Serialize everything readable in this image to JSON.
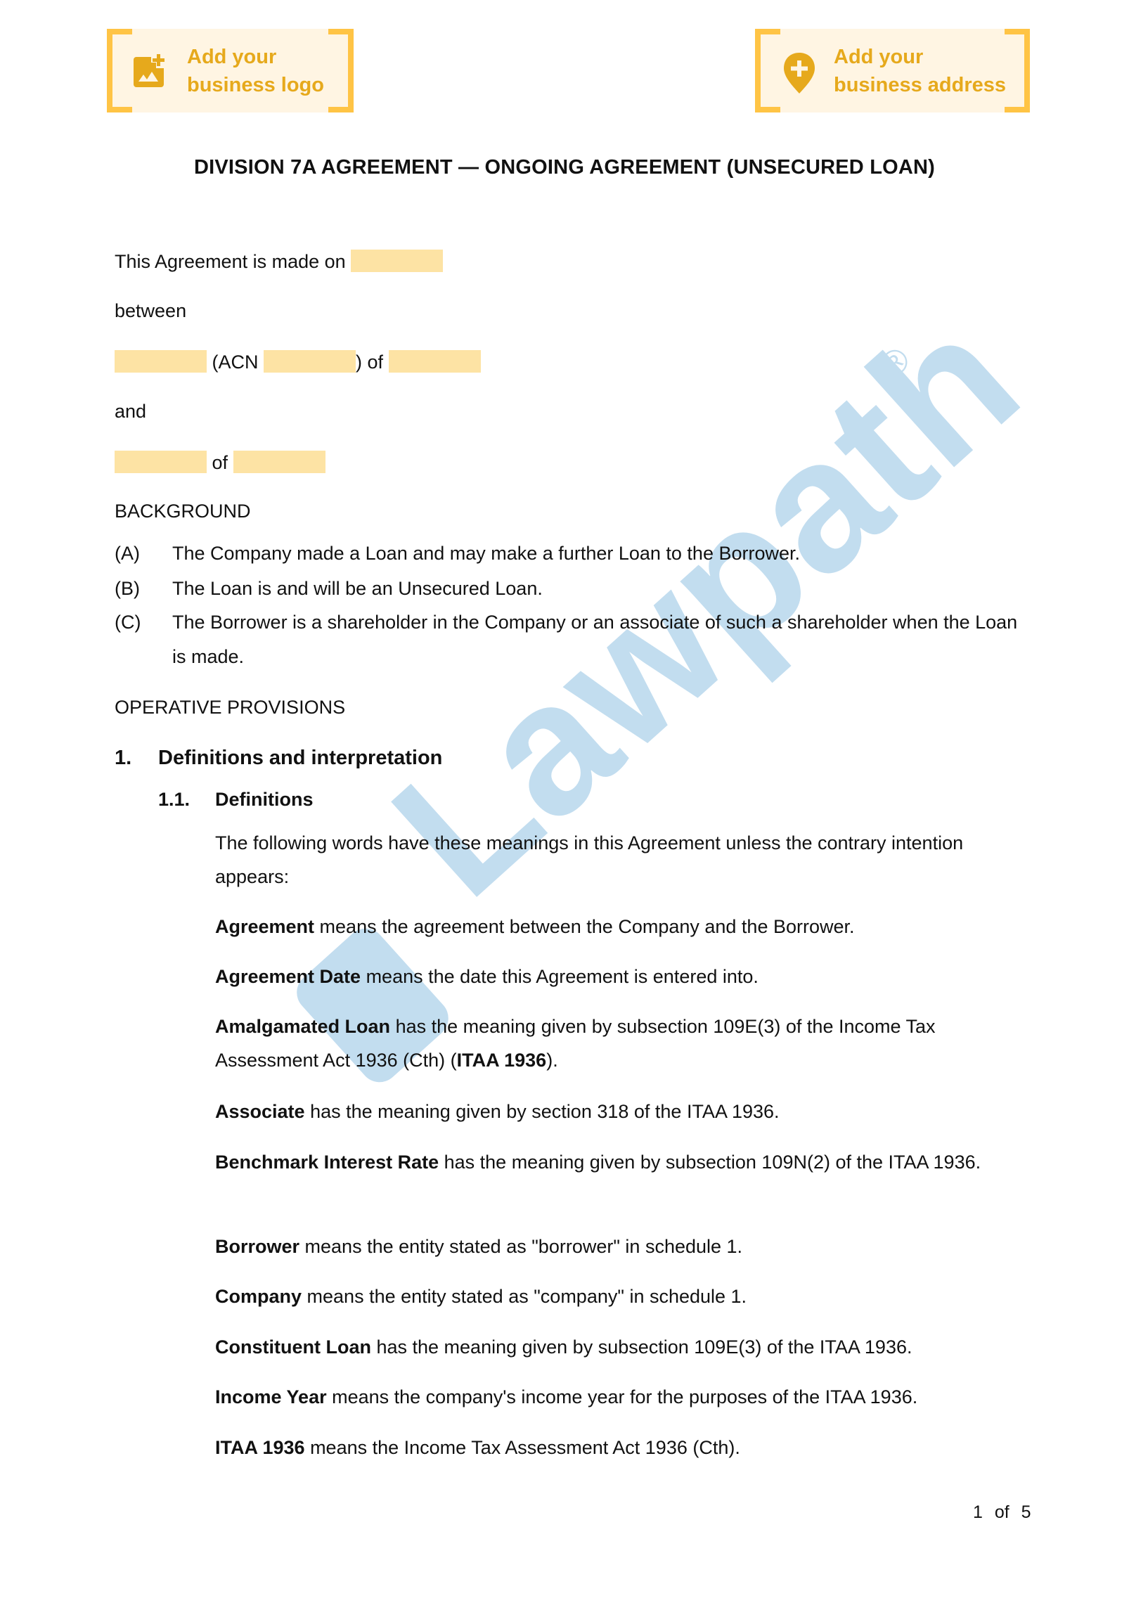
{
  "header": {
    "logo_cta": {
      "line1": "Add your",
      "line2": "business logo",
      "icon": "add-image-icon"
    },
    "address_cta": {
      "line1": "Add your",
      "line2": "business address",
      "icon": "add-location-pin-icon"
    },
    "accent_color": "#e6a91c",
    "bracket_color": "#ffc445",
    "cta_background": "#fff5e3"
  },
  "document": {
    "title": "DIVISION 7A AGREEMENT — ONGOING AGREEMENT (UNSECURED LOAN)",
    "intro": {
      "made_on": "This Agreement is made on",
      "between": "between",
      "acn_open": "(ACN",
      "acn_close": ") of",
      "and": "and",
      "of": "of"
    },
    "placeholder_color": "#fde3a4",
    "background": {
      "heading": "BACKGROUND",
      "items": [
        {
          "label": "(A)",
          "text": "The Company made a Loan and may make a further Loan to the Borrower."
        },
        {
          "label": "(B)",
          "text": "The Loan is and will be an Unsecured Loan."
        },
        {
          "label": "(C)",
          "text": "The Borrower is a shareholder in the Company or an associate of such a shareholder when the Loan is made."
        }
      ]
    },
    "operative_heading": "OPERATIVE PROVISIONS",
    "section1": {
      "number": "1.",
      "title": "Definitions and interpretation"
    },
    "section1_1": {
      "number": "1.1.",
      "title": "Definitions"
    },
    "definitions_intro": "The following words have these meanings in this Agreement unless the contrary intention appears:",
    "definitions": [
      {
        "term": "Agreement",
        "text": " means the agreement between the Company and the Borrower."
      },
      {
        "term": "Agreement Date",
        "text": " means the date this Agreement is entered into."
      },
      {
        "term": "Amalgamated Loan",
        "text": " has the meaning given by subsection 109E(3) of the Income Tax Assessment Act 1936 (Cth) (",
        "term2": "ITAA 1936",
        "tail": ")."
      },
      {
        "term": "Associate",
        "text": " has the meaning given by section 318 of the ITAA 1936."
      },
      {
        "term": "Benchmark Interest Rate",
        "text": " has the meaning given by subsection 109N(2) of the ITAA 1936."
      },
      {
        "term": "Borrower",
        "text": " means the entity stated as \"borrower\" in schedule 1."
      },
      {
        "term": "Company",
        "text": " means the entity stated as \"company\" in schedule 1."
      },
      {
        "term": "Constituent Loan",
        "text": " has the meaning given by subsection 109E(3) of the ITAA 1936."
      },
      {
        "term": "Income Year",
        "text": " means the company's income year for the purposes of the ITAA 1936."
      },
      {
        "term": "ITAA 1936",
        "text": " means the Income Tax Assessment Act 1936 (Cth)."
      }
    ]
  },
  "watermark": {
    "text": "Lawpath",
    "color": "#c2ddef",
    "mark": "®"
  },
  "footer": {
    "page": "1",
    "of": "of",
    "total": "5"
  }
}
